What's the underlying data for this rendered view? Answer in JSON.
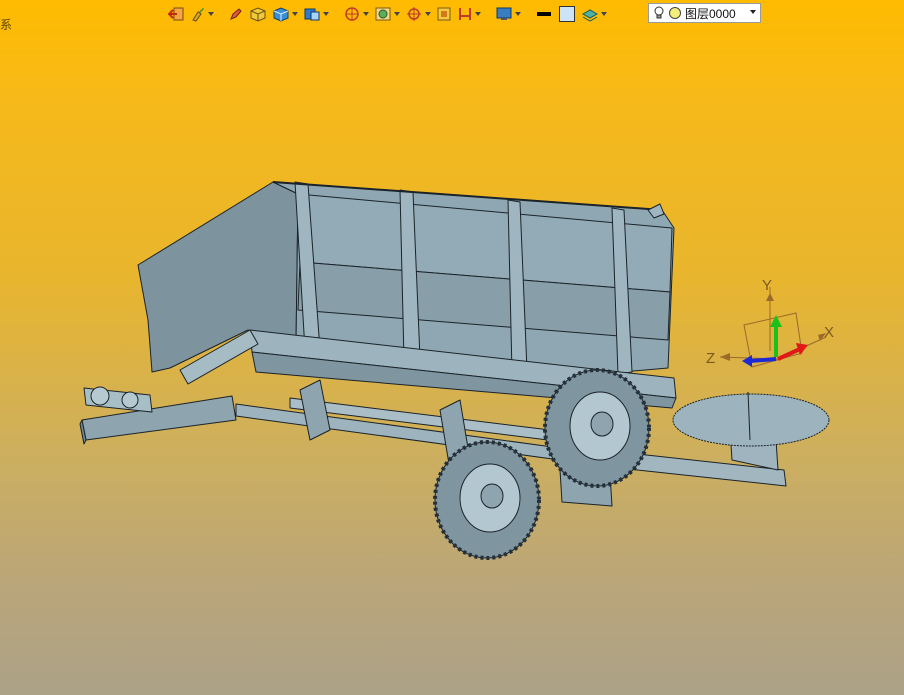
{
  "window": {
    "edge_text": "系"
  },
  "toolbar": {
    "buttons": [
      {
        "name": "exit-sketch",
        "icon": "exit-icon",
        "has_dropdown": false
      },
      {
        "name": "paint-brush",
        "icon": "brush-icon",
        "has_dropdown": true
      },
      {
        "name": "pen",
        "icon": "pen-icon",
        "has_dropdown": false
      },
      {
        "name": "yellow-cube",
        "icon": "yellow-cube-icon",
        "has_dropdown": false
      },
      {
        "name": "blue-cube",
        "icon": "blue-cube-icon",
        "has_dropdown": true
      },
      {
        "name": "view-box",
        "icon": "view-box-icon",
        "has_dropdown": true
      },
      {
        "name": "section",
        "icon": "section-icon",
        "has_dropdown": true
      },
      {
        "name": "render",
        "icon": "render-icon",
        "has_dropdown": true
      },
      {
        "name": "snap",
        "icon": "crosshair-icon",
        "has_dropdown": true
      },
      {
        "name": "background",
        "icon": "square-icon",
        "has_dropdown": false
      },
      {
        "name": "measure",
        "icon": "measure-icon",
        "has_dropdown": true
      },
      {
        "name": "display",
        "icon": "monitor-icon",
        "has_dropdown": true
      },
      {
        "name": "line-color",
        "icon": "black-line-icon",
        "has_dropdown": false
      },
      {
        "name": "fill-color",
        "icon": "light-blue-square-icon",
        "has_dropdown": false
      },
      {
        "name": "layers",
        "icon": "layers-icon",
        "has_dropdown": true
      }
    ],
    "layer_selector": {
      "label": "图层0000",
      "bulb_icon": "bulb-icon",
      "color_icon": "yellow-circle-icon"
    }
  },
  "triad": {
    "x_label": "X",
    "y_label": "Y",
    "z_label": "Z"
  },
  "colors": {
    "model_fill": "#8fa7b2",
    "model_edge": "#1a2329",
    "background_top": "#ffbb00",
    "background_bottom": "#aca288"
  }
}
